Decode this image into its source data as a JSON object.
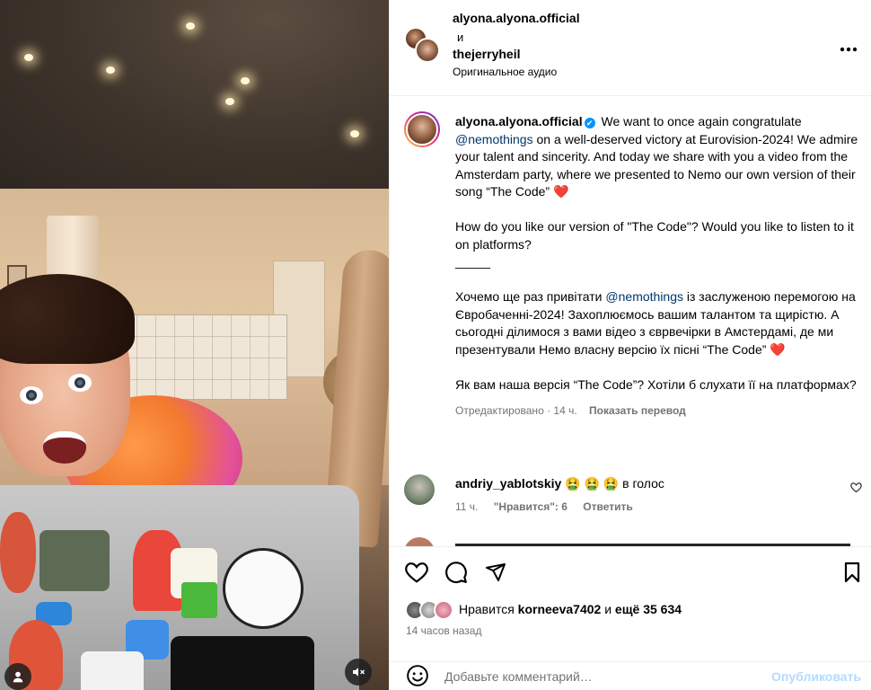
{
  "header": {
    "user1": "alyona.alyona.official",
    "and": "и",
    "user2": "thejerryheil",
    "audio": "Оригинальное аудио",
    "more_icon": "more-horizontal-icon"
  },
  "caption": {
    "username": "alyona.alyona.official",
    "verified_badge": "✔",
    "p1_pre": "We want to once again congratulate",
    "p1_mention": "@nemothings",
    "p1_post": "on a well-deserved victory at Eurovision-2024! We admire your talent and sincerity. And today we share with you a video from the Amsterdam party, where we presented to Nemo our own version of their song “The Code”",
    "heart": "❤️",
    "p2": "How do you like our version of \"The Code\"? Would you like to listen to it on platforms?",
    "sep": "_____",
    "p3_pre": "Хочемо ще раз привітати",
    "p3_mention": "@nemothings",
    "p3_post": "із заслуженою перемогою на Євробаченні-2024! Захоплюємось вашим талантом та щирістю. А сьогодні ділимося з вами відео з єврвечірки в Амстердамі, де ми презентували Немо власну версію їх пісні “The Code”",
    "p4": "Як вам наша версія “The Code”? Хотіли б слухати її на платформах?",
    "edited": "Отредактировано · 14 ч.",
    "translate": "Показать перевод"
  },
  "comment": {
    "username": "andriy_yablotskiy",
    "emojis": "🤮 🤮 🤮",
    "text": "в голос",
    "time": "11 ч.",
    "likes": "\"Нравится\": 6",
    "reply": "Ответить"
  },
  "actions": {
    "like_icon": "heart-outline-icon",
    "comment_icon": "comment-icon",
    "share_icon": "send-icon",
    "save_icon": "bookmark-icon"
  },
  "likes": {
    "prefix": "Нравится",
    "user": "korneeva7402",
    "and": "и",
    "count": "ещё 35 634"
  },
  "timestamp": "14 часов назад",
  "add_comment": {
    "placeholder": "Добавьте комментарий…",
    "publish": "Опубликовать"
  },
  "colors": {
    "link": "#00376b",
    "verified": "#0095f6",
    "muted": "#737373",
    "publish_disabled": "#b3dbff"
  }
}
